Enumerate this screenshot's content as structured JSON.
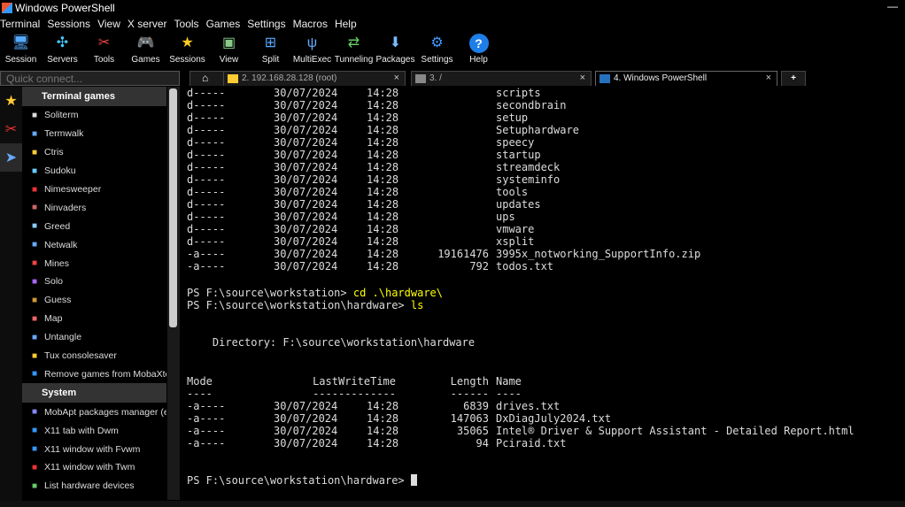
{
  "window": {
    "title": "Windows PowerShell",
    "minimize": "—"
  },
  "menu": [
    "Terminal",
    "Sessions",
    "View",
    "X server",
    "Tools",
    "Games",
    "Settings",
    "Macros",
    "Help"
  ],
  "toolbar": [
    {
      "label": "Session",
      "icon": "session-icon"
    },
    {
      "label": "Servers",
      "icon": "servers-icon"
    },
    {
      "label": "Tools",
      "icon": "tools-icon"
    },
    {
      "label": "Games",
      "icon": "games-icon"
    },
    {
      "label": "Sessions",
      "icon": "sessions-star-icon"
    },
    {
      "label": "View",
      "icon": "view-icon"
    },
    {
      "label": "Split",
      "icon": "split-icon"
    },
    {
      "label": "MultiExec",
      "icon": "multiexec-icon"
    },
    {
      "label": "Tunneling",
      "icon": "tunneling-icon"
    },
    {
      "label": "Packages",
      "icon": "packages-icon"
    },
    {
      "label": "Settings",
      "icon": "settings-icon"
    },
    {
      "label": "Help",
      "icon": "help-icon"
    }
  ],
  "quick_connect": {
    "placeholder": "Quick connect..."
  },
  "tabs": [
    {
      "label": "",
      "icon": "home-icon"
    },
    {
      "label": "2. 192.168.28.128 (root)",
      "icon": "ssh-icon",
      "close": "×"
    },
    {
      "label": "3. /",
      "icon": "terminal-icon",
      "close": "×"
    },
    {
      "label": "4. Windows PowerShell",
      "icon": "powershell-icon",
      "close": "×"
    },
    {
      "label": "+",
      "icon": "new-tab-icon"
    }
  ],
  "sidebar": {
    "sections": [
      {
        "title": "Terminal games",
        "items": [
          "Soliterm",
          "Termwalk",
          "Ctris",
          "Sudoku",
          "Nimesweeper",
          "Ninvaders",
          "Greed",
          "Netwalk",
          "Mines",
          "Solo",
          "Guess",
          "Map",
          "Untangle",
          "Tux consolesaver",
          "Remove games from MobaXterm"
        ]
      },
      {
        "title": "System",
        "items": [
          "MobApt packages manager (expe",
          "X11 tab with Dwm",
          "X11 window with Fvwm",
          "X11 window with Twm",
          "List hardware devices"
        ]
      }
    ]
  },
  "terminal": {
    "dir_rows": [
      [
        "d-----",
        "30/07/2024",
        "14:28",
        "",
        "scripts"
      ],
      [
        "d-----",
        "30/07/2024",
        "14:28",
        "",
        "secondbrain"
      ],
      [
        "d-----",
        "30/07/2024",
        "14:28",
        "",
        "setup"
      ],
      [
        "d-----",
        "30/07/2024",
        "14:28",
        "",
        "Setuphardware"
      ],
      [
        "d-----",
        "30/07/2024",
        "14:28",
        "",
        "speecy"
      ],
      [
        "d-----",
        "30/07/2024",
        "14:28",
        "",
        "startup"
      ],
      [
        "d-----",
        "30/07/2024",
        "14:28",
        "",
        "streamdeck"
      ],
      [
        "d-----",
        "30/07/2024",
        "14:28",
        "",
        "systeminfo"
      ],
      [
        "d-----",
        "30/07/2024",
        "14:28",
        "",
        "tools"
      ],
      [
        "d-----",
        "30/07/2024",
        "14:28",
        "",
        "updates"
      ],
      [
        "d-----",
        "30/07/2024",
        "14:28",
        "",
        "ups"
      ],
      [
        "d-----",
        "30/07/2024",
        "14:28",
        "",
        "vmware"
      ],
      [
        "d-----",
        "30/07/2024",
        "14:28",
        "",
        "xsplit"
      ],
      [
        "-a----",
        "30/07/2024",
        "14:28",
        "19161476",
        "3995x_notworking_SupportInfo.zip"
      ],
      [
        "-a----",
        "30/07/2024",
        "14:28",
        "792",
        "todos.txt"
      ]
    ],
    "prompt1": "PS F:\\source\\workstation> ",
    "cmd1": "cd .\\hardware\\",
    "prompt2": "PS F:\\source\\workstation\\hardware> ",
    "cmd2": "ls",
    "directory_line": "    Directory: F:\\source\\workstation\\hardware",
    "header": {
      "mode": "Mode",
      "lastwrite": "LastWriteTime",
      "length": "Length",
      "name": "Name"
    },
    "underline": {
      "mode": "----",
      "lastwrite": "-------------",
      "length": "------",
      "name": "----"
    },
    "file_rows": [
      [
        "-a----",
        "30/07/2024",
        "14:28",
        "6839",
        "drives.txt"
      ],
      [
        "-a----",
        "30/07/2024",
        "14:28",
        "147063",
        "DxDiagJuly2024.txt"
      ],
      [
        "-a----",
        "30/07/2024",
        "14:28",
        "35065",
        "Intel® Driver & Support Assistant - Detailed Report.html"
      ],
      [
        "-a----",
        "30/07/2024",
        "14:28",
        "94",
        "Pciraid.txt"
      ]
    ],
    "prompt3": "PS F:\\source\\workstation\\hardware> "
  }
}
